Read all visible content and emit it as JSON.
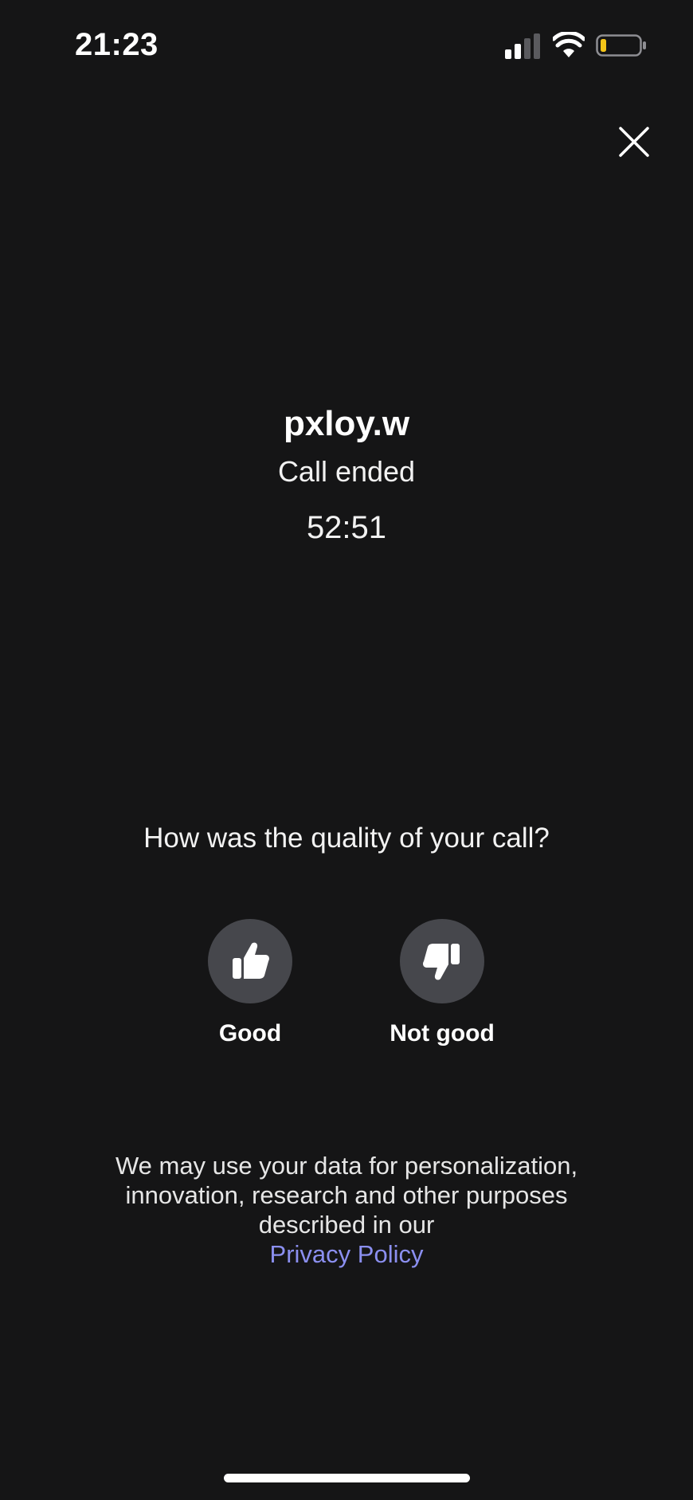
{
  "status_bar": {
    "time": "21:23",
    "battery_color": "#f5c518"
  },
  "call": {
    "caller_name": "pxloy.w",
    "status": "Call ended",
    "duration": "52:51"
  },
  "feedback": {
    "question": "How was the quality of your call?",
    "good_label": "Good",
    "not_good_label": "Not good"
  },
  "privacy": {
    "text": "We may use your data for personalization, innovation, research and other purposes described in our",
    "link_label": "Privacy Policy",
    "link_color": "#8b8ff0"
  },
  "icons": {
    "close": "close-icon",
    "thumbs_up": "thumbs-up-icon",
    "thumbs_down": "thumbs-down-icon"
  }
}
